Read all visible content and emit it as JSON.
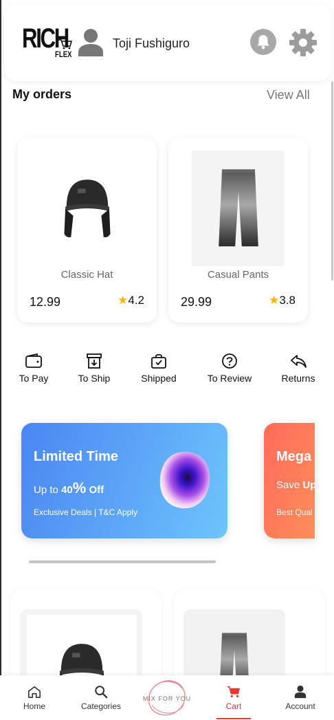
{
  "header": {
    "logo_main": "RICH",
    "logo_sub": "FLEX",
    "user_name": "Toji Fushiguro"
  },
  "orders": {
    "title": "My orders",
    "view_all": "View All",
    "products": [
      {
        "name": "Classic Hat",
        "price": "12.99",
        "rating": "4.2"
      },
      {
        "name": "Casual Pants",
        "price": "29.99",
        "rating": "3.8"
      }
    ],
    "statuses": [
      {
        "label": "To Pay",
        "icon": "wallet-icon"
      },
      {
        "label": "To Ship",
        "icon": "box-download-icon"
      },
      {
        "label": "Shipped",
        "icon": "bag-check-icon"
      },
      {
        "label": "To Review",
        "icon": "question-circle-icon"
      },
      {
        "label": "Returns",
        "icon": "reply-arrow-icon"
      }
    ]
  },
  "banners": [
    {
      "title": "Limited Time",
      "sub_prefix": "Up to ",
      "sub_value": "40",
      "sub_pct": "%",
      "sub_suffix": " Off",
      "footer": "Exclusive Deals | T&C Apply",
      "color": "#4a86f2"
    },
    {
      "title": "Mega",
      "sub_prefix": "Save ",
      "sub_bold": "Up",
      "footer": "Best Qual",
      "color": "#ff6b5b"
    }
  ],
  "nav": {
    "items": [
      {
        "label": "Home",
        "icon": "home-icon"
      },
      {
        "label": "Categories",
        "icon": "search-icon"
      },
      {
        "label": "MIX FOR YOU",
        "icon": "mix-logo"
      },
      {
        "label": "Cart",
        "icon": "cart-icon"
      },
      {
        "label": "Account",
        "icon": "person-icon"
      }
    ],
    "active": "Cart",
    "accent": "#e53935"
  }
}
